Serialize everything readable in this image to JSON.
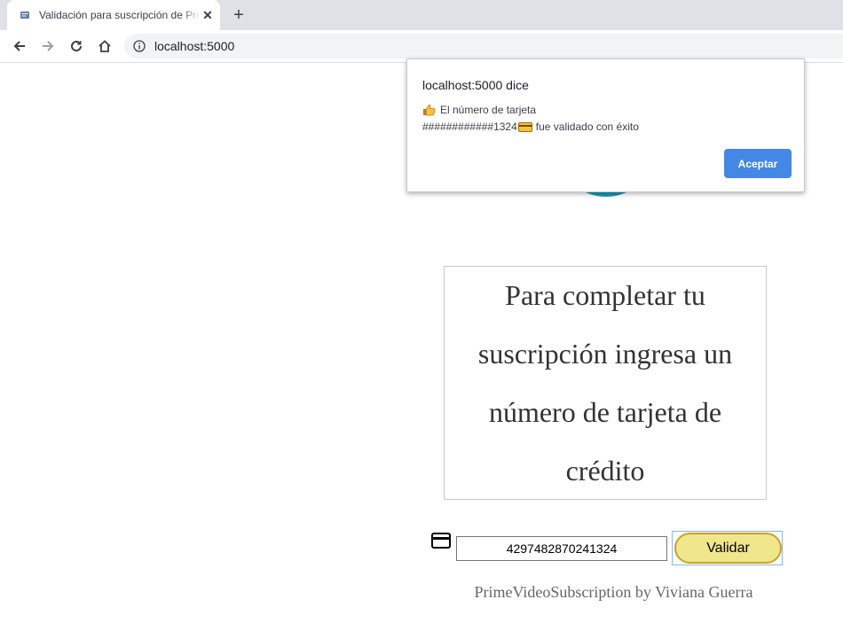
{
  "browser": {
    "tab_title": "Validación para suscripción de Pri",
    "url": "localhost:5000",
    "icons": [
      "favicon-icon",
      "close-icon",
      "new-tab-icon",
      "back-icon",
      "forward-icon",
      "reload-icon",
      "home-icon",
      "info-icon"
    ]
  },
  "page": {
    "message": "Para completar tu suscripción ingresa un número de tarjeta de crédito",
    "card_number_value": "4297482870241324",
    "validate_label": "Validar",
    "footer": "PrimeVideoSubscription by Viviana Guerra",
    "colors": {
      "button_bg": "#f0e68c",
      "button_border": "#c9a227",
      "logo": "#1d97b3"
    }
  },
  "alert": {
    "origin": "localhost:5000 dice",
    "line1": "El número de tarjeta",
    "masked_number": "############1324",
    "line2_suffix": "fue validado con éxito",
    "accept_label": "Aceptar",
    "colors": {
      "accept_bg": "#4487e5"
    }
  }
}
